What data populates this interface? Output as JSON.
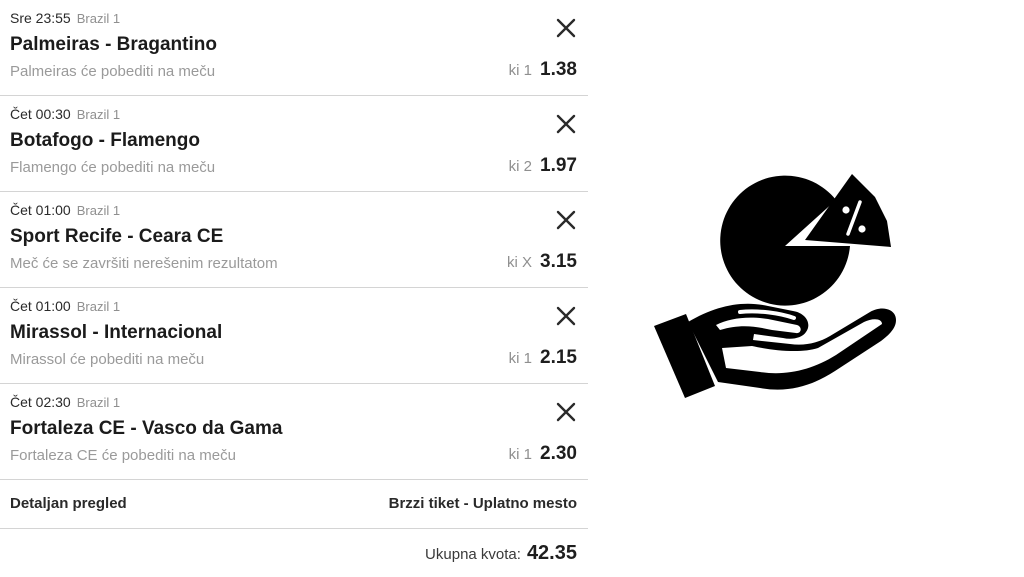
{
  "bets": [
    {
      "time": "Sre 23:55",
      "league": "Brazil 1",
      "match": "Palmeiras - Bragantino",
      "pick": "Palmeiras će pobediti na meču",
      "odds_label": "ki 1",
      "odds": "1.38"
    },
    {
      "time": "Čet 00:30",
      "league": "Brazil 1",
      "match": "Botafogo - Flamengo",
      "pick": "Flamengo će pobediti na meču",
      "odds_label": "ki 2",
      "odds": "1.97"
    },
    {
      "time": "Čet 01:00",
      "league": "Brazil 1",
      "match": "Sport Recife - Ceara CE",
      "pick": "Meč će se završiti nerešenim rezultatom",
      "odds_label": "ki X",
      "odds": "3.15"
    },
    {
      "time": "Čet 01:00",
      "league": "Brazil 1",
      "match": "Mirassol - Internacional",
      "pick": "Mirassol će pobediti na meču",
      "odds_label": "ki 1",
      "odds": "2.15"
    },
    {
      "time": "Čet 02:30",
      "league": "Brazil 1",
      "match": "Fortaleza CE - Vasco da Gama",
      "pick": "Fortaleza CE će pobediti na meču",
      "odds_label": "ki 1",
      "odds": "2.30"
    }
  ],
  "footer": {
    "details_link": "Detaljan pregled",
    "quick_ticket_link": "Brzzi tiket - Uplatno mesto"
  },
  "total": {
    "label": "Ukupna kvota:",
    "value": "42.35"
  },
  "icons": {
    "close": "close-icon",
    "illustration": "hand-holding-pie-chart-percent-icon"
  },
  "colors": {
    "text_primary": "#1e1e1e",
    "text_muted": "#9a9a9a",
    "divider": "#d4d4d4",
    "icon": "#000000"
  }
}
